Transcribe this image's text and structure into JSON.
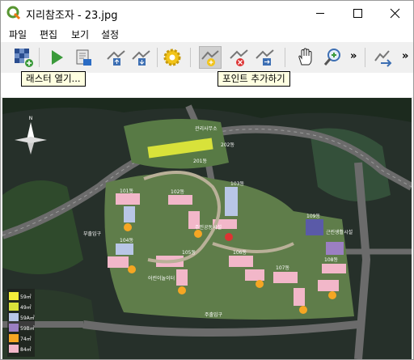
{
  "window": {
    "title": "지리참조자 - 23.jpg",
    "minimize_glyph": "─",
    "maximize_glyph": "☐",
    "close_glyph": "✕"
  },
  "menu": [
    "파일",
    "편집",
    "보기",
    "설정"
  ],
  "toolbar": {
    "buttons": [
      {
        "name": "open-raster-button",
        "icon": "raster-grid-plus-icon"
      },
      {
        "name": "start-georeferencing-button",
        "icon": "play-icon"
      },
      {
        "name": "generate-gdal-script-button",
        "icon": "script-scroll-icon"
      },
      {
        "name": "load-gcp-points-button",
        "icon": "gcp-load-icon"
      },
      {
        "name": "save-gcp-points-button",
        "icon": "gcp-save-icon"
      },
      {
        "name": "transformation-settings-button",
        "icon": "gear-icon"
      },
      {
        "name": "add-point-button",
        "icon": "add-point-icon",
        "active": true
      },
      {
        "name": "delete-point-button",
        "icon": "delete-point-icon"
      },
      {
        "name": "move-gcp-button",
        "icon": "move-gcp-icon"
      },
      {
        "name": "pan-button",
        "icon": "hand-icon"
      },
      {
        "name": "zoom-in-button",
        "icon": "zoom-in-icon"
      },
      {
        "name": "link-georeferencer-button",
        "icon": "link-arrow-icon"
      }
    ],
    "overflow_glyph": "»"
  },
  "tooltips": {
    "open_raster": "래스터 열기...",
    "add_point": "포인트 추가하기"
  },
  "map": {
    "north": "N",
    "legend": [
      "59㎡",
      "49㎡",
      "59A㎡",
      "59B㎡",
      "74㎡",
      "84㎡"
    ],
    "legend_colors": [
      "#f4ef3a",
      "#d8e23a",
      "#b8c6e6",
      "#9b7fc2",
      "#f5a623",
      "#f2b7c9"
    ],
    "building_labels": [
      "101동",
      "102동",
      "103동",
      "104동",
      "105동",
      "106동",
      "107동",
      "108동",
      "109동",
      "201동",
      "202동"
    ],
    "area_labels": [
      "주민공동시설",
      "근린생활시설",
      "어린이놀이터",
      "관리사무소",
      "주출입구",
      "부출입구"
    ]
  }
}
